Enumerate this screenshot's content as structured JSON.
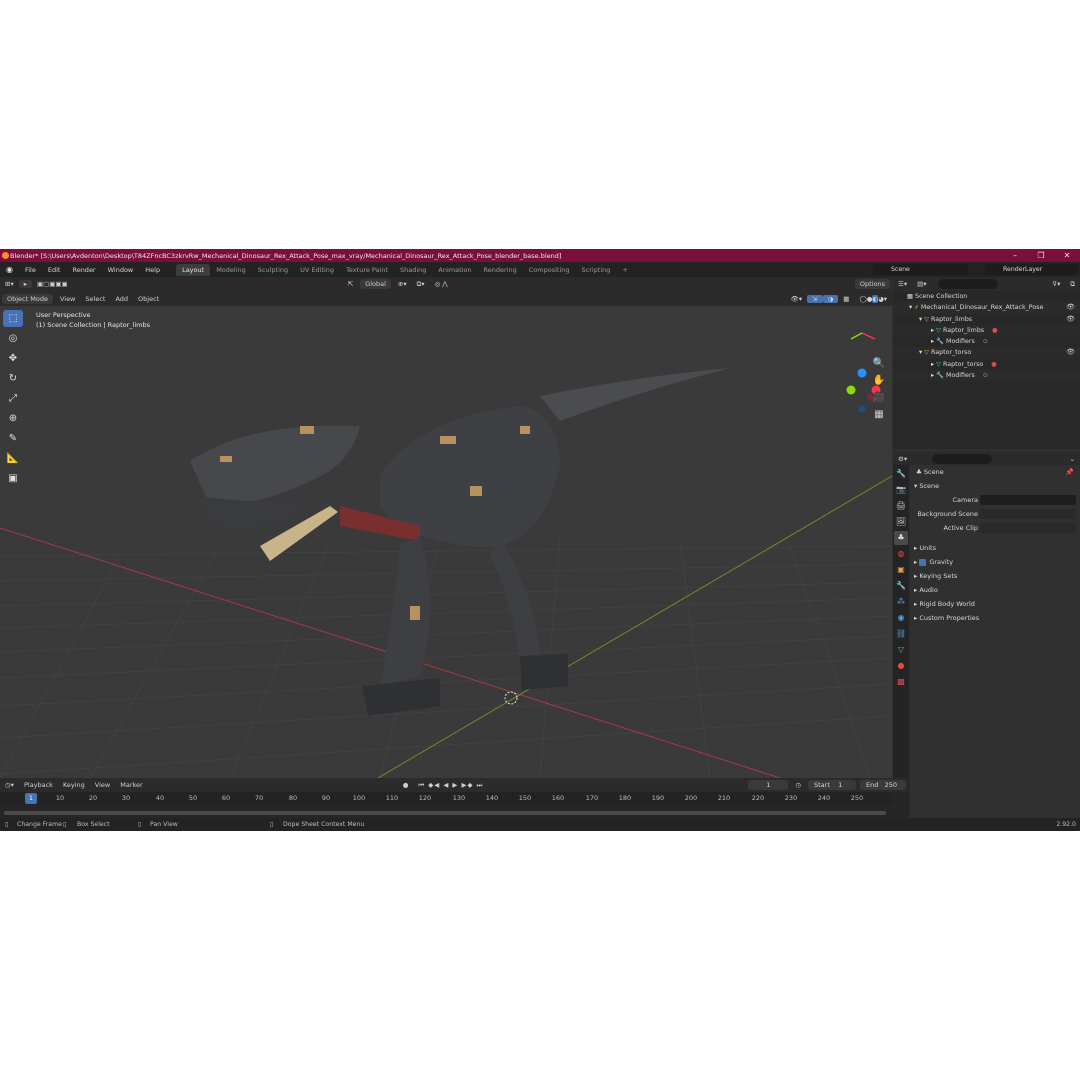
{
  "window": {
    "title": "Blender* [S:\\Users\\Avdenton\\Desktop\\T84ZFncBC3zkrvRw_Mechanical_Dinosaur_Rex_Attack_Pose_max_vray/Mechanical_Dinosaur_Rex_Attack_Pose_blender_base.blend]",
    "minimize": "–",
    "maximize": "❐",
    "close": "✕"
  },
  "menu": [
    "File",
    "Edit",
    "Render",
    "Window",
    "Help"
  ],
  "workspaces": [
    "Layout",
    "Modeling",
    "Sculpting",
    "UV Editing",
    "Texture Paint",
    "Shading",
    "Animation",
    "Rendering",
    "Compositing",
    "Scripting"
  ],
  "add_workspace": "+",
  "scene_name": "Scene",
  "render_layer": "RenderLayer",
  "viewport_header": {
    "transform_orientation": "Global",
    "options": "Options",
    "mode": "Object Mode",
    "view": "View",
    "select": "Select",
    "add": "Add",
    "object": "Object"
  },
  "viewport": {
    "perspective": "User Perspective",
    "collection_info": "(1) Scene Collection | Raptor_limbs",
    "axis_x": "X",
    "axis_y": "Y",
    "axis_z": "Z"
  },
  "outliner": {
    "rows": [
      {
        "label": "Scene Collection",
        "indent": 0
      },
      {
        "label": "Mechanical_Dinosaur_Rex_Attack_Pose",
        "indent": 1
      },
      {
        "label": "Raptor_limbs",
        "indent": 2
      },
      {
        "label": "Raptor_limbs",
        "indent": 3
      },
      {
        "label": "Modifiers",
        "indent": 3
      },
      {
        "label": "Raptor_torso",
        "indent": 2
      },
      {
        "label": "Raptor_torso",
        "indent": 3
      },
      {
        "label": "Modifiers",
        "indent": 3
      }
    ]
  },
  "properties": {
    "context": "Scene",
    "panel": "Scene",
    "camera_label": "Camera",
    "background_label": "Background Scene",
    "active_clip_label": "Active Clip",
    "sections": [
      "Units",
      "Gravity",
      "Keying Sets",
      "Audio",
      "Rigid Body World",
      "Custom Properties"
    ]
  },
  "timeline": {
    "playback": "Playback",
    "keying": "Keying",
    "view": "View",
    "marker": "Marker",
    "current_frame": "1",
    "start_label": "Start",
    "start": "1",
    "end_label": "End",
    "end": "250",
    "ruler": [
      "1",
      "10",
      "20",
      "30",
      "40",
      "50",
      "60",
      "70",
      "80",
      "90",
      "100",
      "110",
      "120",
      "130",
      "140",
      "150",
      "160",
      "170",
      "180",
      "190",
      "200",
      "210",
      "220",
      "230",
      "240",
      "250"
    ]
  },
  "statusbar": {
    "change_frame": "Change Frame",
    "box_select": "Box Select",
    "pan_view": "Pan View",
    "context_menu": "Dope Sheet Context Menu",
    "version": "2.92.0"
  },
  "colors": {
    "title_bar": "#7a0f3a",
    "accent": "#4772b3",
    "axis_x": "#ff3352",
    "axis_y": "#8bdc00",
    "axis_z": "#2890ff"
  }
}
